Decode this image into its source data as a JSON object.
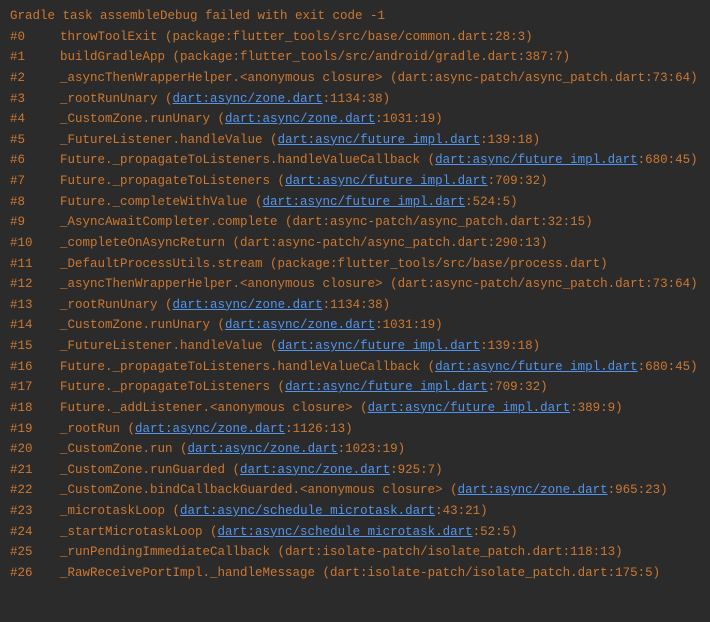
{
  "header": "Gradle task assembleDebug failed with exit code -1",
  "frames": [
    {
      "num": "#0",
      "method": "throwToolExit",
      "prefix": " (package:flutter_tools/src/base/common.dart:28:3)",
      "link": null,
      "suffix": null
    },
    {
      "num": "#1",
      "method": "buildGradleApp",
      "prefix": " (package:flutter_tools/src/android/gradle.dart:387:7)",
      "link": null,
      "suffix": null
    },
    {
      "num": "#2",
      "method": "_asyncThenWrapperHelper.<anonymous closure>",
      "prefix": " (dart:async-patch/async_patch.dart:73:64)",
      "link": null,
      "suffix": null
    },
    {
      "num": "#3",
      "method": "_rootRunUnary",
      "prefix": " (",
      "link": "dart:async/zone.dart",
      "suffix": ":1134:38)"
    },
    {
      "num": "#4",
      "method": "_CustomZone.runUnary",
      "prefix": " (",
      "link": "dart:async/zone.dart",
      "suffix": ":1031:19)"
    },
    {
      "num": "#5",
      "method": "_FutureListener.handleValue",
      "prefix": " (",
      "link": "dart:async/future_impl.dart",
      "suffix": ":139:18)"
    },
    {
      "num": "#6",
      "method": "Future._propagateToListeners.handleValueCallback",
      "prefix": " (",
      "link": "dart:async/future_impl.dart",
      "suffix": ":680:45)"
    },
    {
      "num": "#7",
      "method": "Future._propagateToListeners",
      "prefix": " (",
      "link": "dart:async/future_impl.dart",
      "suffix": ":709:32)"
    },
    {
      "num": "#8",
      "method": "Future._completeWithValue",
      "prefix": " (",
      "link": "dart:async/future_impl.dart",
      "suffix": ":524:5)"
    },
    {
      "num": "#9",
      "method": "_AsyncAwaitCompleter.complete",
      "prefix": " (dart:async-patch/async_patch.dart:32:15)",
      "link": null,
      "suffix": null
    },
    {
      "num": "#10",
      "method": "_completeOnAsyncReturn",
      "prefix": " (dart:async-patch/async_patch.dart:290:13)",
      "link": null,
      "suffix": null
    },
    {
      "num": "#11",
      "method": "_DefaultProcessUtils.stream",
      "prefix": " (package:flutter_tools/src/base/process.dart)",
      "link": null,
      "suffix": null
    },
    {
      "num": "#12",
      "method": "_asyncThenWrapperHelper.<anonymous closure>",
      "prefix": " (dart:async-patch/async_patch.dart:73:64)",
      "link": null,
      "suffix": null
    },
    {
      "num": "#13",
      "method": "_rootRunUnary",
      "prefix": " (",
      "link": "dart:async/zone.dart",
      "suffix": ":1134:38)"
    },
    {
      "num": "#14",
      "method": "_CustomZone.runUnary",
      "prefix": " (",
      "link": "dart:async/zone.dart",
      "suffix": ":1031:19)"
    },
    {
      "num": "#15",
      "method": "_FutureListener.handleValue",
      "prefix": " (",
      "link": "dart:async/future_impl.dart",
      "suffix": ":139:18)"
    },
    {
      "num": "#16",
      "method": "Future._propagateToListeners.handleValueCallback",
      "prefix": " (",
      "link": "dart:async/future_impl.dart",
      "suffix": ":680:45)"
    },
    {
      "num": "#17",
      "method": "Future._propagateToListeners",
      "prefix": " (",
      "link": "dart:async/future_impl.dart",
      "suffix": ":709:32)"
    },
    {
      "num": "#18",
      "method": "Future._addListener.<anonymous closure>",
      "prefix": " (",
      "link": "dart:async/future_impl.dart",
      "suffix": ":389:9)"
    },
    {
      "num": "#19",
      "method": "_rootRun",
      "prefix": " (",
      "link": "dart:async/zone.dart",
      "suffix": ":1126:13)"
    },
    {
      "num": "#20",
      "method": "_CustomZone.run",
      "prefix": " (",
      "link": "dart:async/zone.dart",
      "suffix": ":1023:19)"
    },
    {
      "num": "#21",
      "method": "_CustomZone.runGuarded",
      "prefix": " (",
      "link": "dart:async/zone.dart",
      "suffix": ":925:7)"
    },
    {
      "num": "#22",
      "method": "_CustomZone.bindCallbackGuarded.<anonymous closure>",
      "prefix": " (",
      "link": "dart:async/zone.dart",
      "suffix": ":965:23)"
    },
    {
      "num": "#23",
      "method": "_microtaskLoop",
      "prefix": " (",
      "link": "dart:async/schedule_microtask.dart",
      "suffix": ":43:21)"
    },
    {
      "num": "#24",
      "method": "_startMicrotaskLoop",
      "prefix": " (",
      "link": "dart:async/schedule_microtask.dart",
      "suffix": ":52:5)"
    },
    {
      "num": "#25",
      "method": "_runPendingImmediateCallback",
      "prefix": " (dart:isolate-patch/isolate_patch.dart:118:13)",
      "link": null,
      "suffix": null
    },
    {
      "num": "#26",
      "method": "_RawReceivePortImpl._handleMessage",
      "prefix": " (dart:isolate-patch/isolate_patch.dart:175:5)",
      "link": null,
      "suffix": null
    }
  ]
}
